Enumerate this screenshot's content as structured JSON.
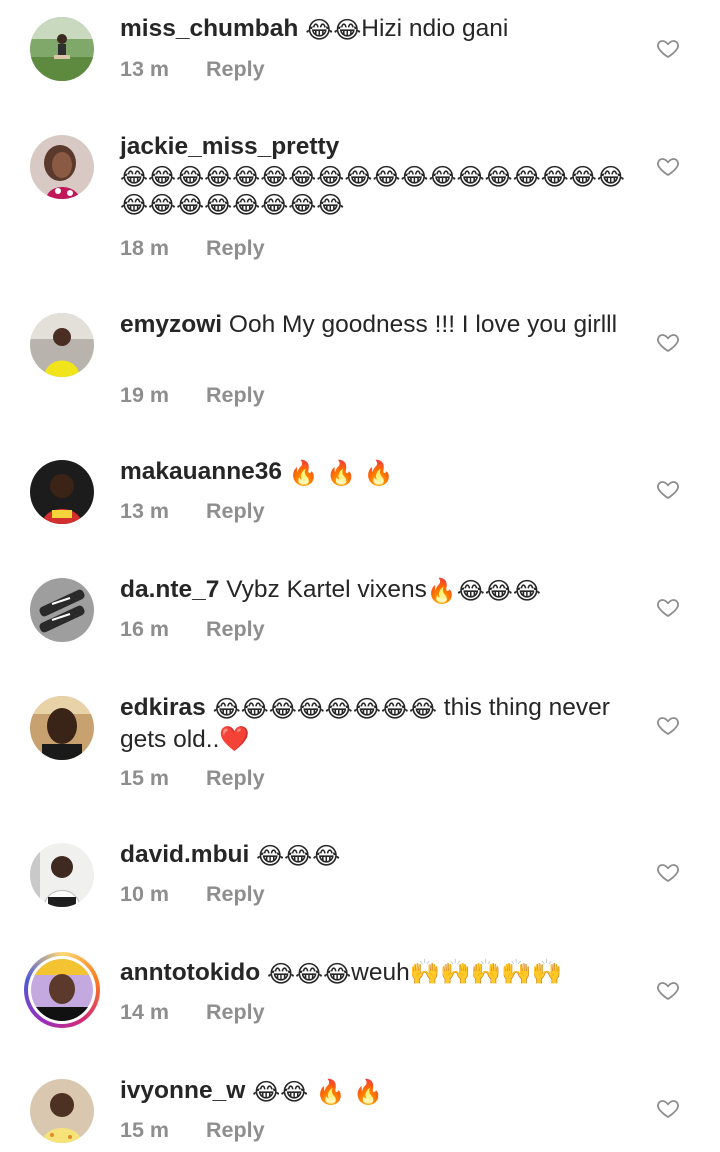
{
  "comments": [
    {
      "username": "miss_chumbah",
      "text_before": " ",
      "emoji_group": "😂😂",
      "text_after": "Hizi ndio gani",
      "time": "13 m",
      "reply_label": "Reply"
    },
    {
      "username": "jackie_miss_pretty",
      "text_before": " ",
      "emoji_group": "😂😂😂😂😂😂😂😂😂😂😂😂😂😂😂😂😂😂😂😂😂😂😂😂😂😂",
      "text_after": "",
      "time": "18 m",
      "reply_label": "Reply"
    },
    {
      "username": "emyzowi",
      "text_before": " Ooh My goodness !!! I love you girlll",
      "emoji_group": "",
      "text_after": "",
      "time": "19 m",
      "reply_label": "Reply"
    },
    {
      "username": "makauanne36",
      "text_before": " ",
      "emoji_group": "🔥 🔥 🔥",
      "text_after": "",
      "time": "13 m",
      "reply_label": "Reply"
    },
    {
      "username": "da.nte_7",
      "text_before": " Vybz Kartel vixens",
      "emoji_group": "🔥😂😂😂",
      "text_after": "",
      "time": "16 m",
      "reply_label": "Reply"
    },
    {
      "username": "edkiras",
      "text_before": " ",
      "emoji_group": "😂😂😂😂😂😂😂😂",
      "text_after": " this thing never gets old..❤️",
      "time": "15 m",
      "reply_label": "Reply"
    },
    {
      "username": "david.mbui",
      "text_before": " ",
      "emoji_group": "😂😂😂",
      "text_after": "",
      "time": "10 m",
      "reply_label": "Reply"
    },
    {
      "username": "anntotokido",
      "text_before": " ",
      "emoji_group": "😂😂😂",
      "text_after": "weuh🙌🙌🙌🙌🙌",
      "time": "14 m",
      "reply_label": "Reply"
    },
    {
      "username": "ivyonne_w",
      "text_before": " ",
      "emoji_group": "😂😂 🔥 🔥",
      "text_after": "",
      "time": "15 m",
      "reply_label": "Reply"
    }
  ],
  "icons": {
    "like": "heart-outline-icon"
  },
  "colors": {
    "text": "#262626",
    "meta": "#8e8e8e"
  }
}
